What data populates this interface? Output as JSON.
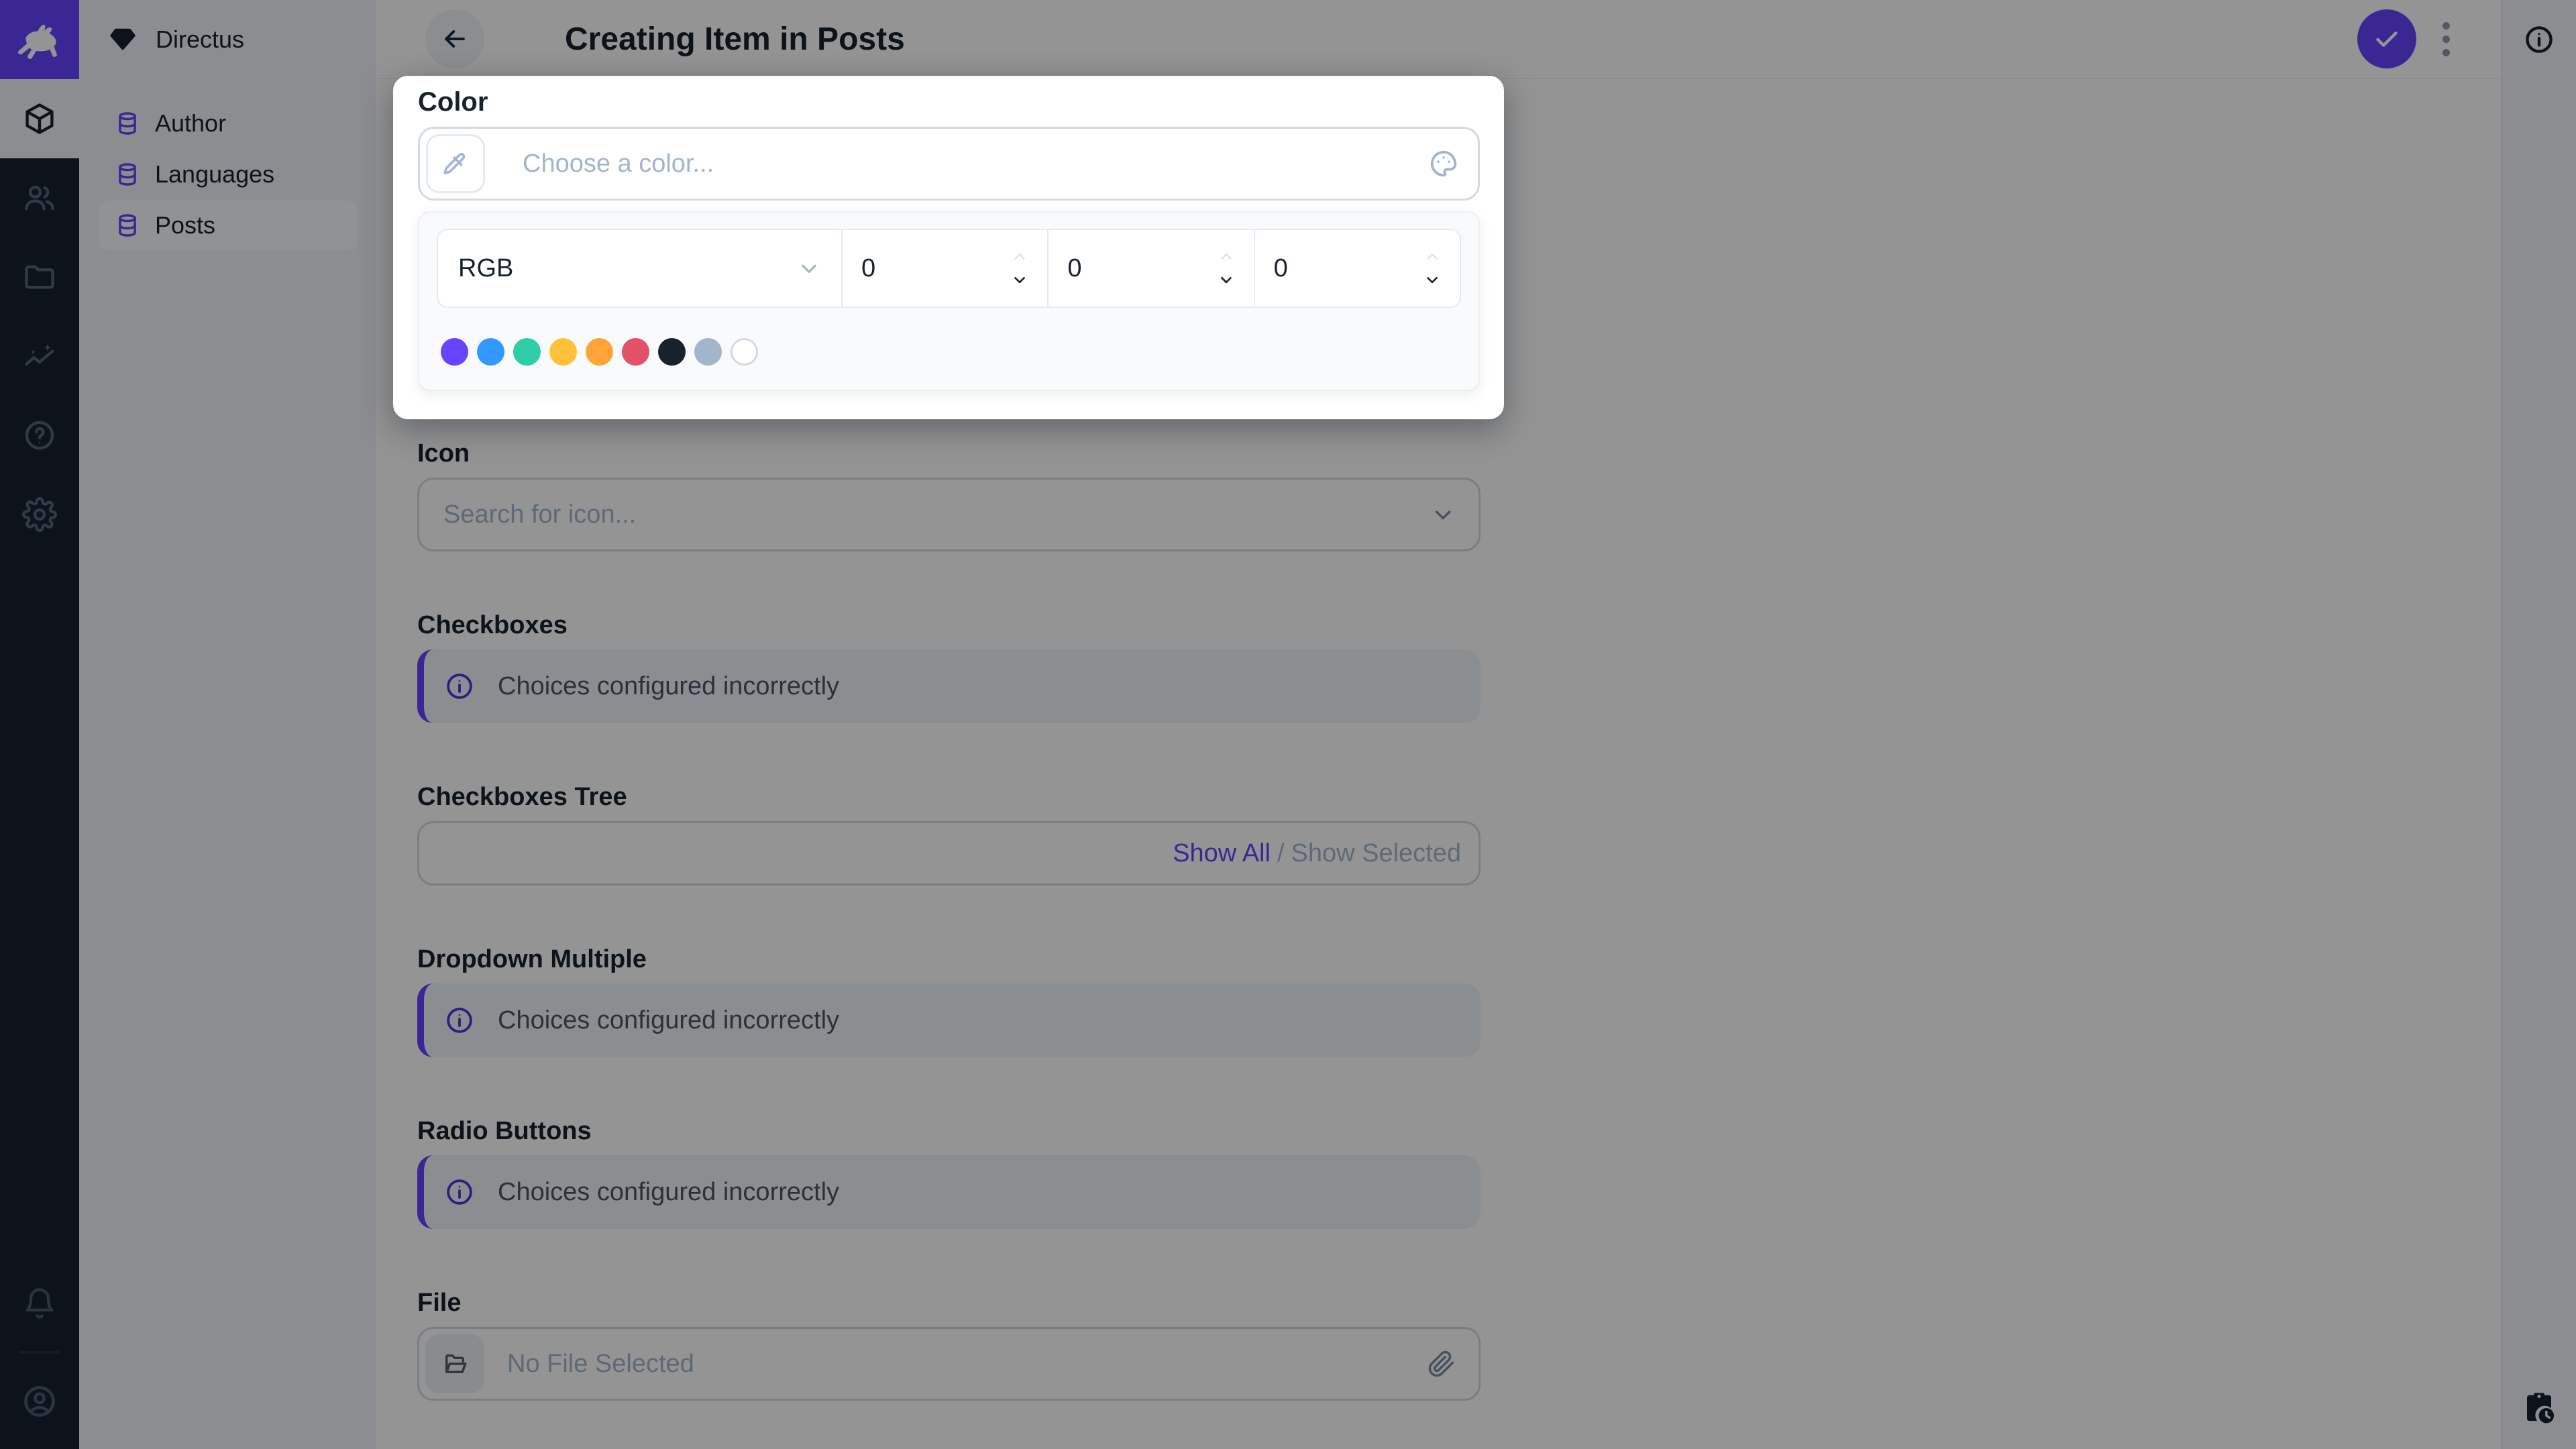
{
  "app": {
    "brand_color": "#6644FF"
  },
  "module_bar": {
    "modules": [
      {
        "name": "content",
        "icon": "box-icon",
        "active": true
      },
      {
        "name": "user-directory",
        "icon": "people-icon",
        "active": false
      },
      {
        "name": "file-library",
        "icon": "folder-icon",
        "active": false
      },
      {
        "name": "insights",
        "icon": "insights-icon",
        "active": false
      },
      {
        "name": "documentation",
        "icon": "help-icon",
        "active": false
      },
      {
        "name": "settings",
        "icon": "gear-icon",
        "active": false
      }
    ]
  },
  "sidebar": {
    "project_name": "Directus",
    "items": [
      {
        "label": "Author",
        "active": false
      },
      {
        "label": "Languages",
        "active": false
      },
      {
        "label": "Posts",
        "active": true
      }
    ]
  },
  "header": {
    "title": "Creating Item in Posts"
  },
  "popup": {
    "label": "Color",
    "input_placeholder": "Choose a color...",
    "color_model": "RGB",
    "channels": [
      "0",
      "0",
      "0"
    ],
    "swatches": [
      "#6644FF",
      "#3399FF",
      "#2ECDA7",
      "#FFC23B",
      "#FFA439",
      "#E35169",
      "#18222F",
      "#A2B5CD",
      "#FFFFFF"
    ]
  },
  "fields": {
    "icon": {
      "label": "Icon",
      "placeholder": "Search for icon..."
    },
    "checkboxes": {
      "label": "Checkboxes",
      "notice": "Choices configured incorrectly"
    },
    "checkboxes_tree": {
      "label": "Checkboxes Tree",
      "show_all": "Show All",
      "separator": "/",
      "show_selected": "Show Selected"
    },
    "dropdown_multiple": {
      "label": "Dropdown Multiple",
      "notice": "Choices configured incorrectly"
    },
    "radio_buttons": {
      "label": "Radio Buttons",
      "notice": "Choices configured incorrectly"
    },
    "file": {
      "label": "File",
      "placeholder": "No File Selected"
    }
  }
}
